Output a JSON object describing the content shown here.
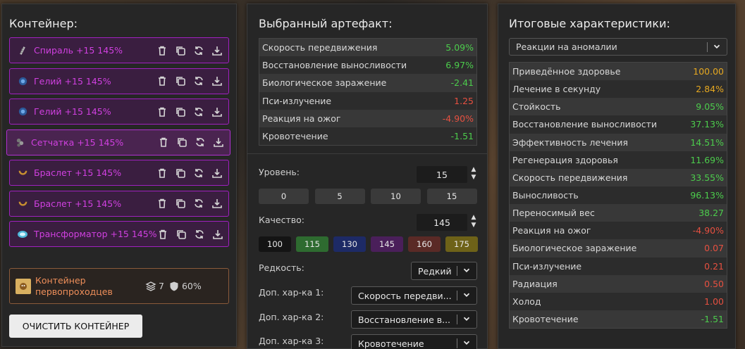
{
  "left": {
    "title": "Контейнер:",
    "items": [
      {
        "name": "Спираль +15 145%",
        "icon": "spiral-artifact-icon",
        "selected": false
      },
      {
        "name": "Гелий +15 145%",
        "icon": "helium-artifact-icon",
        "selected": false
      },
      {
        "name": "Гелий +15 145%",
        "icon": "helium-artifact-icon",
        "selected": false
      },
      {
        "name": "Сетчатка +15 145%",
        "icon": "retina-artifact-icon",
        "selected": true
      },
      {
        "name": "Браслет +15 145%",
        "icon": "bracelet-artifact-icon",
        "selected": false
      },
      {
        "name": "Браслет +15 145%",
        "icon": "bracelet-artifact-icon",
        "selected": false
      },
      {
        "name": "Трансформатор +15 145%",
        "icon": "transformer-artifact-icon",
        "selected": false
      }
    ],
    "container": {
      "name": "Контейнер первопроходцев",
      "slots": "7",
      "protection": "60%"
    },
    "clear_button": "ОЧИСТИТЬ КОНТЕЙНЕР"
  },
  "mid": {
    "title": "Выбранный артефакт:",
    "stats": [
      {
        "label": "Скорость передвижения",
        "value": "5.09%",
        "tone": "pos"
      },
      {
        "label": "Восстановление выносливости",
        "value": "6.97%",
        "tone": "pos"
      },
      {
        "label": "Биологическое заражение",
        "value": "-2.41",
        "tone": "pos"
      },
      {
        "label": "Пси-излучение",
        "value": "1.25",
        "tone": "neg"
      },
      {
        "label": "Реакция на ожог",
        "value": "-4.90%",
        "tone": "neg"
      },
      {
        "label": "Кровотечение",
        "value": "-1.51",
        "tone": "pos"
      }
    ],
    "level_label": "Уровень:",
    "level_value": "15",
    "level_presets": [
      "0",
      "5",
      "10",
      "15"
    ],
    "quality_label": "Качество:",
    "quality_value": "145",
    "quality_presets": [
      {
        "label": "100",
        "color": "#141414"
      },
      {
        "label": "115",
        "color": "#2e6b30"
      },
      {
        "label": "130",
        "color": "#1d2a66"
      },
      {
        "label": "145",
        "color": "#4a1f5a"
      },
      {
        "label": "160",
        "color": "#5a2a26"
      },
      {
        "label": "175",
        "color": "#6e6218"
      }
    ],
    "rarity_label": "Редкость:",
    "rarity_value": "Редкий",
    "extra1_label": "Доп. хар-ка 1:",
    "extra1_value": "Скорость передви...",
    "extra2_label": "Доп. хар-ка 2:",
    "extra2_value": "Восстановление в...",
    "extra3_label": "Доп. хар-ка 3:",
    "extra3_value": "Кровотечение"
  },
  "right": {
    "title": "Итоговые характеристики:",
    "filter_value": "Реакции на аномалии",
    "stats": [
      {
        "label": "Приведённое здоровье",
        "value": "100.00",
        "tone": "gold"
      },
      {
        "label": "Лечение в секунду",
        "value": "2.84%",
        "tone": "gold"
      },
      {
        "label": "Стойкость",
        "value": "9.05%",
        "tone": "pos"
      },
      {
        "label": "Восстановление выносливости",
        "value": "37.13%",
        "tone": "pos"
      },
      {
        "label": "Эффективность лечения",
        "value": "14.51%",
        "tone": "pos"
      },
      {
        "label": "Регенерация здоровья",
        "value": "11.69%",
        "tone": "pos"
      },
      {
        "label": "Скорость передвижения",
        "value": "33.55%",
        "tone": "pos"
      },
      {
        "label": "Выносливость",
        "value": "96.13%",
        "tone": "pos"
      },
      {
        "label": "Переносимый вес",
        "value": "38.27",
        "tone": "pos"
      },
      {
        "label": "Реакция на ожог",
        "value": "-4.90%",
        "tone": "neg"
      },
      {
        "label": "Биологическое заражение",
        "value": "0.07",
        "tone": "neg"
      },
      {
        "label": "Пси-излучение",
        "value": "0.21",
        "tone": "neg"
      },
      {
        "label": "Радиация",
        "value": "0.50",
        "tone": "neg"
      },
      {
        "label": "Холод",
        "value": "1.00",
        "tone": "neg"
      },
      {
        "label": "Кровотечение",
        "value": "-1.51",
        "tone": "pos"
      }
    ]
  }
}
